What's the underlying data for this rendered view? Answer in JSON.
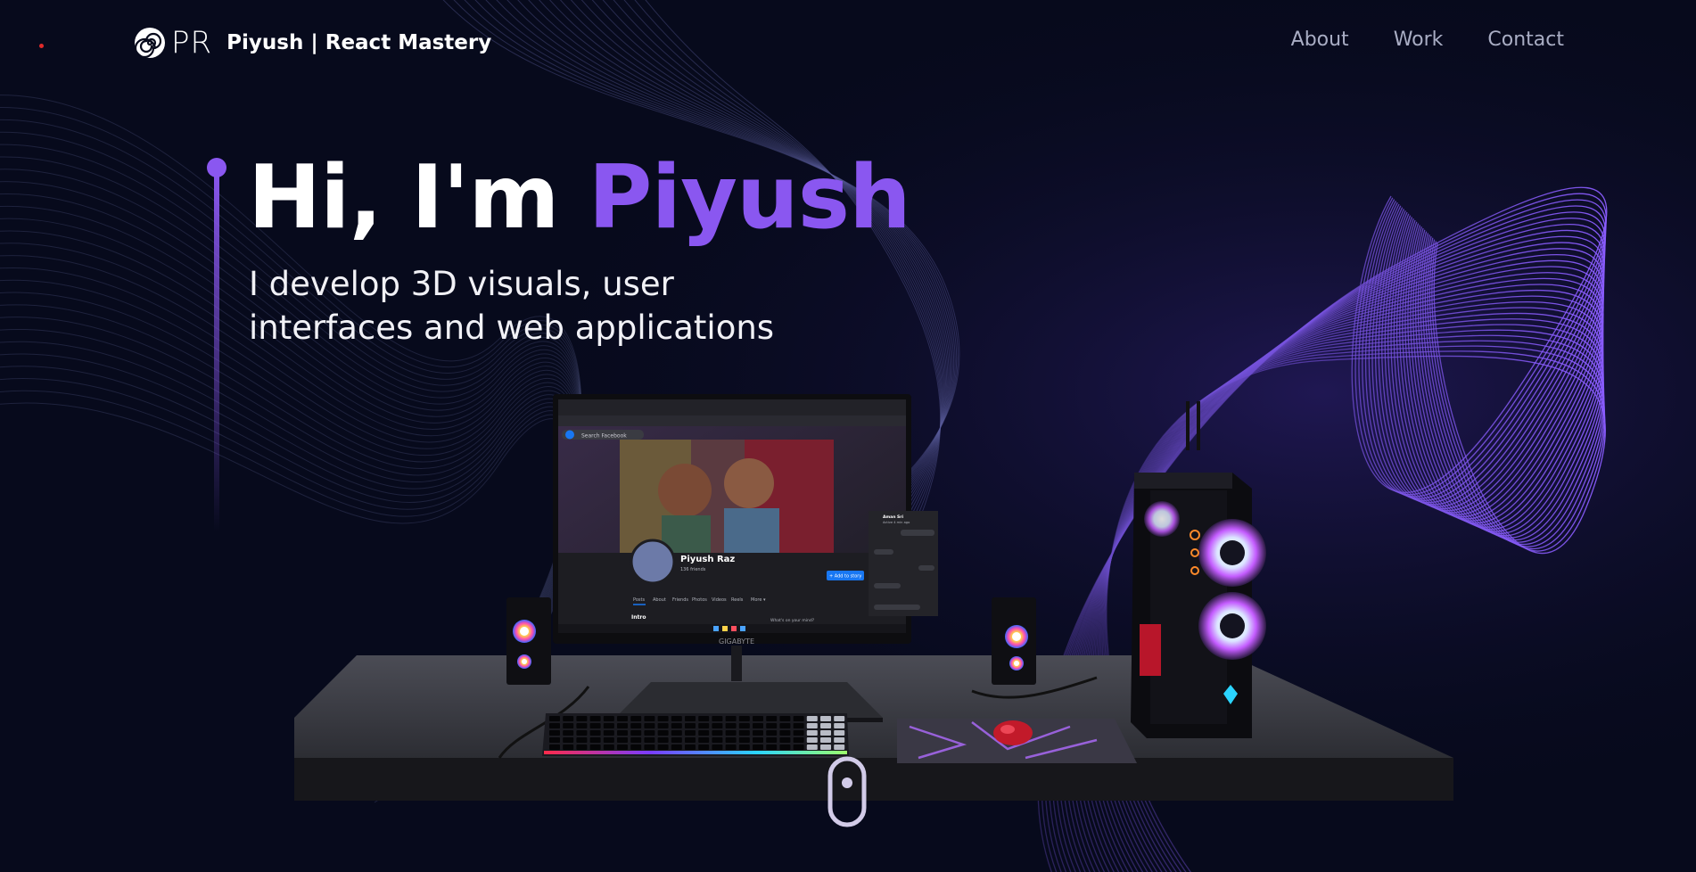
{
  "nav": {
    "logo_initials": "PR",
    "logo_name": "Piyush | React Mastery",
    "links": [
      "About",
      "Work",
      "Contact"
    ]
  },
  "hero": {
    "greeting": "Hi, I'm ",
    "name": "Piyush",
    "subtitle_line1": "I develop 3D visuals, user",
    "subtitle_line2": "interfaces and web applications"
  },
  "monitor": {
    "brand": "GIGABYTE",
    "search_placeholder": "Search Facebook",
    "profile_name": "Piyush Raz",
    "profile_friends": "136 friends",
    "add_story": "+ Add to story",
    "tabs": [
      "Posts",
      "About",
      "Friends",
      "Photos",
      "Videos",
      "Reels",
      "More ▾"
    ],
    "intro_label": "Intro",
    "post_prompt": "What's on your mind?",
    "chat_name": "Aman Sri",
    "chat_status": "Active 4 min ago"
  },
  "colors": {
    "background": "#070a1c",
    "accent": "#8a57f0",
    "nav_link": "#a9adc4"
  },
  "icons": {
    "logo": "spiral-logo-icon",
    "scroll": "mouse-scroll-icon"
  }
}
